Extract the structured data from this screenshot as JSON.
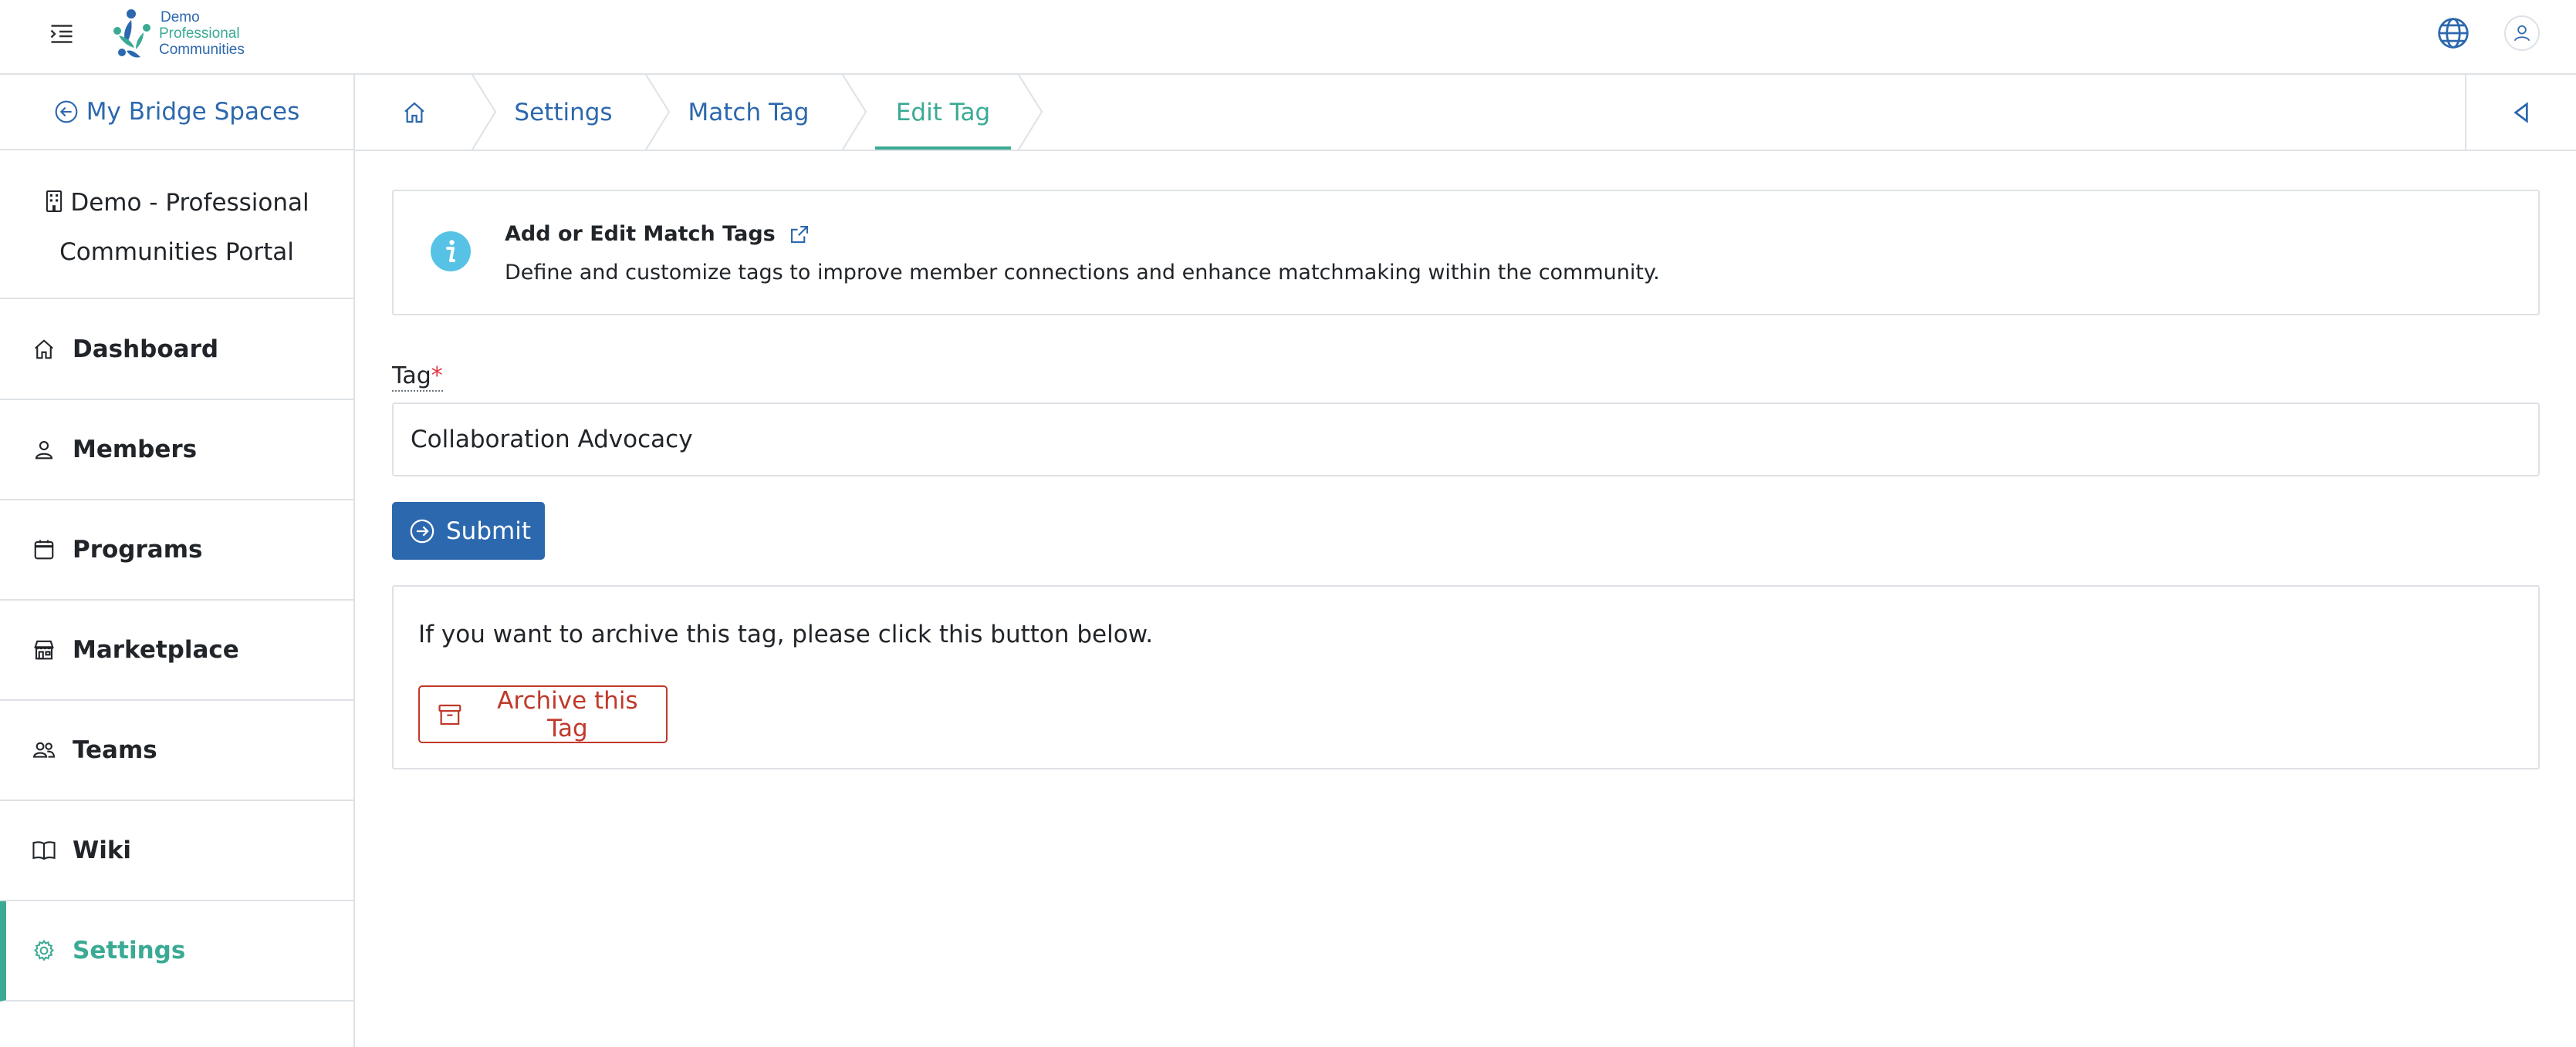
{
  "header": {
    "menu_icon": "menu-indent-icon",
    "logo": {
      "line1": "Demo",
      "line2": "Professional",
      "line3": "Communities"
    },
    "globe_icon": "globe-icon",
    "avatar_icon": "user-icon"
  },
  "sidebar": {
    "back_label": "My Bridge Spaces",
    "org_name": "Demo - Professional Communities Portal",
    "items": [
      {
        "label": "Dashboard",
        "icon": "home-icon"
      },
      {
        "label": "Members",
        "icon": "person-icon"
      },
      {
        "label": "Programs",
        "icon": "calendar-icon"
      },
      {
        "label": "Marketplace",
        "icon": "shop-icon"
      },
      {
        "label": "Teams",
        "icon": "people-icon"
      },
      {
        "label": "Wiki",
        "icon": "book-icon"
      },
      {
        "label": "Settings",
        "icon": "gear-icon",
        "active": true
      }
    ]
  },
  "breadcrumb": {
    "home_icon": "home-icon",
    "items": [
      "Settings",
      "Match Tag",
      "Edit Tag"
    ],
    "active": "Edit Tag"
  },
  "info": {
    "title": "Add or Edit Match Tags",
    "description": "Define and customize tags to improve member connections and enhance matchmaking within the community."
  },
  "form": {
    "tag_label": "Tag",
    "required_mark": "*",
    "tag_value": "Collaboration Advocacy",
    "submit_label": "Submit"
  },
  "archive": {
    "text": "If you want to archive this tag, please click this button below.",
    "button_label": "Archive this Tag"
  },
  "colors": {
    "primary": "#2c68ad",
    "accent": "#3aaa94",
    "danger": "#c0392b",
    "info": "#56c3e6"
  }
}
